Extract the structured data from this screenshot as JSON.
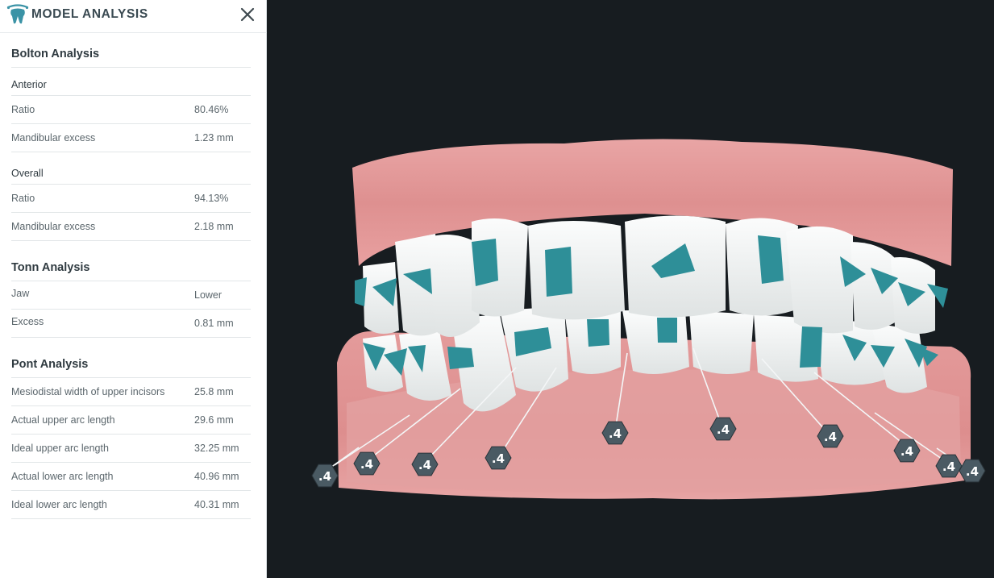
{
  "panel": {
    "title": "MODEL ANALYSIS",
    "logo_icon": "tooth-logo-icon",
    "close_icon": "close-icon"
  },
  "bolton": {
    "title": "Bolton Analysis",
    "anterior": {
      "label": "Anterior",
      "rows": [
        {
          "label": "Ratio",
          "value": "80.46%"
        },
        {
          "label": "Mandibular excess",
          "value": "1.23 mm"
        }
      ]
    },
    "overall": {
      "label": "Overall",
      "rows": [
        {
          "label": "Ratio",
          "value": "94.13%"
        },
        {
          "label": "Mandibular excess",
          "value": "2.18 mm"
        }
      ]
    }
  },
  "tonn": {
    "title": "Tonn Analysis",
    "rows": [
      {
        "label": "Jaw",
        "value": "Lower"
      },
      {
        "label": "Excess",
        "value": "0.81 mm"
      }
    ]
  },
  "pont": {
    "title": "Pont Analysis",
    "rows": [
      {
        "label": "Mesiodistal width of upper incisors",
        "value": "25.8 mm"
      },
      {
        "label": "Actual upper arc length",
        "value": "29.6 mm"
      },
      {
        "label": "Ideal upper arc length",
        "value": "32.25 mm"
      },
      {
        "label": "Actual lower arc length",
        "value": "40.96 mm"
      },
      {
        "label": "Ideal lower arc length",
        "value": "40.31 mm"
      }
    ]
  },
  "viewport": {
    "marker_label": ".4",
    "colors": {
      "background": "#171c20",
      "gum": "#e39a9a",
      "tooth": "#f1f3f3",
      "attachment": "#2e8f98",
      "marker": "#4a5a63"
    }
  }
}
